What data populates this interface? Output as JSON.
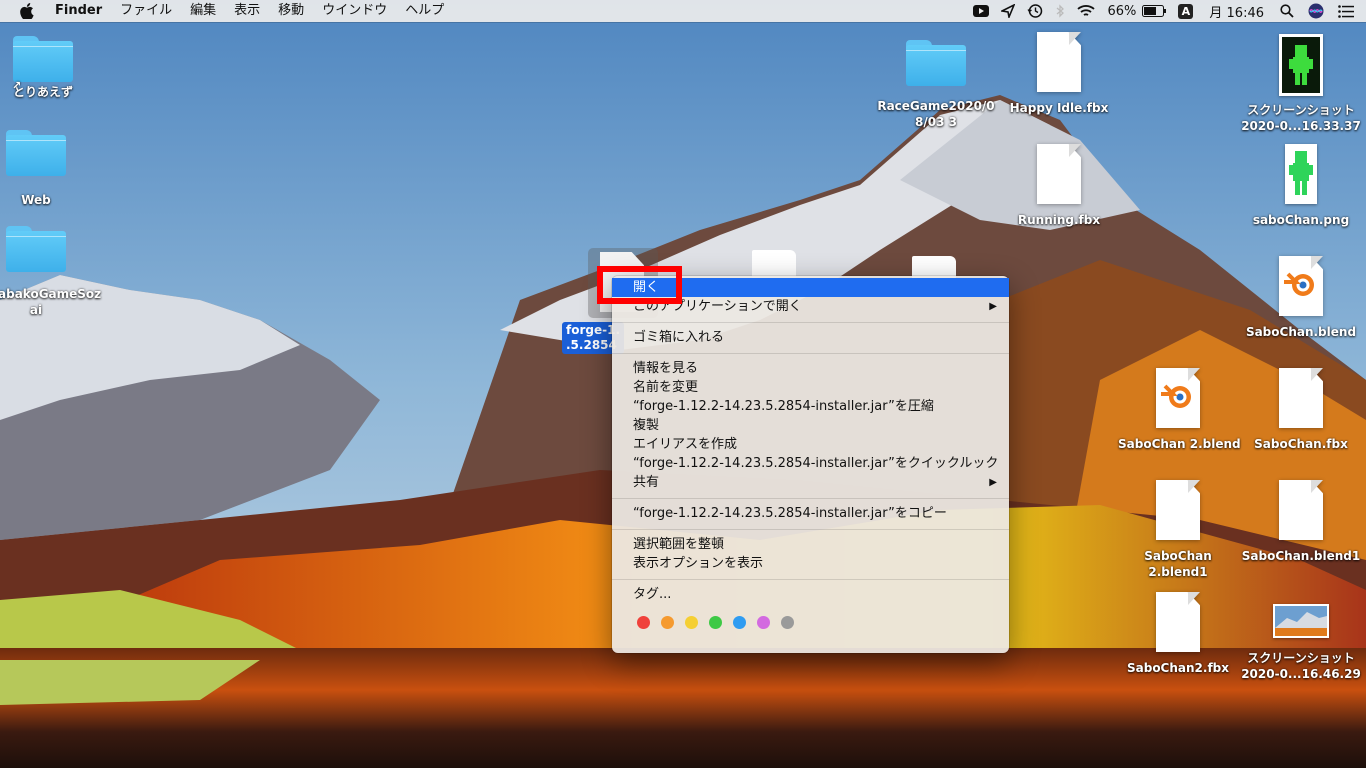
{
  "menubar": {
    "app_name": "Finder",
    "menus": [
      "ファイル",
      "編集",
      "表示",
      "移動",
      "ウインドウ",
      "ヘルプ"
    ],
    "battery": "66%",
    "input_mode": "A",
    "clock": "月 16:46"
  },
  "desktop": {
    "left_icons": [
      {
        "label": "とりあえず",
        "kind": "folder-alias"
      },
      {
        "label": "Web",
        "kind": "folder"
      },
      {
        "label": "abakoGameSoz",
        "label2": "ai",
        "kind": "folder"
      }
    ],
    "right_icons": [
      {
        "label": "RaceGame2020/0",
        "label2": "8/03 3",
        "kind": "folder"
      },
      {
        "label": "Happy Idle.fbx",
        "kind": "document"
      },
      {
        "label": "スクリーンショット",
        "label2": "2020-0...16.33.37",
        "kind": "screenshot"
      },
      {
        "label": "Running.fbx",
        "kind": "document"
      },
      {
        "label": "saboChan.png",
        "kind": "image"
      },
      {
        "label": "SaboChan.blend",
        "kind": "blender"
      },
      {
        "label": "SaboChan 2.blend",
        "kind": "blender"
      },
      {
        "label": "SaboChan.fbx",
        "kind": "document"
      },
      {
        "label": "SaboChan",
        "label2": "2.blend1",
        "kind": "document"
      },
      {
        "label": "SaboChan.blend1",
        "kind": "document"
      },
      {
        "label": "SaboChan2.fbx",
        "kind": "document"
      },
      {
        "label": "スクリーンショット",
        "label2": "2020-0...16.46.29",
        "kind": "screenshot"
      }
    ],
    "selected_file": {
      "label": "forge-1.",
      "label2": ".5.2854"
    }
  },
  "context_menu": {
    "items": [
      {
        "label": "開く",
        "highlighted": true
      },
      {
        "label": "このアプリケーションで開く",
        "submenu": true
      },
      {
        "label": "ゴミ箱に入れる"
      },
      {
        "label": "情報を見る"
      },
      {
        "label": "名前を変更"
      },
      {
        "label": "“forge-1.12.2-14.23.5.2854-installer.jar”を圧縮"
      },
      {
        "label": "複製"
      },
      {
        "label": "エイリアスを作成"
      },
      {
        "label": "“forge-1.12.2-14.23.5.2854-installer.jar”をクイックルック"
      },
      {
        "label": "共有",
        "submenu": true
      },
      {
        "label": "“forge-1.12.2-14.23.5.2854-installer.jar”をコピー"
      },
      {
        "label": "選択範囲を整頓"
      },
      {
        "label": "表示オプションを表示"
      },
      {
        "label": "タグ..."
      }
    ],
    "tag_colors": [
      "#f0413b",
      "#f59a2f",
      "#f5cf33",
      "#3ec945",
      "#2f9cf1",
      "#d36ae0",
      "#9a9a9a"
    ]
  },
  "colors": {
    "highlight": "#1f6cf0",
    "annotation": "#ff0000"
  }
}
